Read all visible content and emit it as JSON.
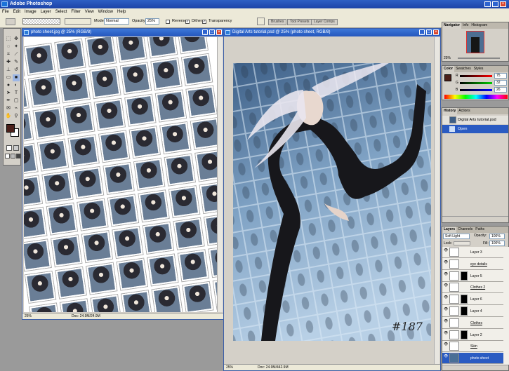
{
  "app": {
    "title": "Adobe Photoshop"
  },
  "menu": [
    "File",
    "Edit",
    "Image",
    "Layer",
    "Select",
    "Filter",
    "View",
    "Window",
    "Help"
  ],
  "options": {
    "mode_label": "Mode:",
    "mode_value": "Normal",
    "opacity_label": "Opacity:",
    "opacity_value": "25%",
    "reverse_label": "Reverse",
    "dither_label": "Dither",
    "transparency_label": "Transparency"
  },
  "palette_well": [
    "Brushes",
    "Tool Presets",
    "Layer Comps"
  ],
  "doc1": {
    "title": "photo sheet.jpg @ 25% (RGB/8)",
    "zoom": "25%",
    "doc_size": "Doc: 24.9M/24.9M"
  },
  "doc2": {
    "title": "Digital Arts tutorial.psd @ 25% (photo sheet, RGB/8)",
    "zoom": "25%",
    "doc_size": "Doc: 24.9M/442.9M",
    "signature": "#187"
  },
  "navigator": {
    "tabs": [
      "Navigator",
      "Info",
      "Histogram"
    ],
    "zoom": "25%"
  },
  "color": {
    "tabs": [
      "Color",
      "Swatches",
      "Styles"
    ],
    "r_label": "R",
    "r_value": "75",
    "g_label": "G",
    "g_value": "32",
    "b_label": "B",
    "b_value": "26",
    "foreground": "#4b201a"
  },
  "history": {
    "tabs": [
      "History",
      "Actions"
    ],
    "snapshot": "Digital Arts tutorial.psd",
    "items": [
      "Open"
    ]
  },
  "layers": {
    "tabs": [
      "Layers",
      "Channels",
      "Paths"
    ],
    "blend_mode": "Soft Light",
    "opacity_label": "Opacity:",
    "opacity_value": "100%",
    "lock_label": "Lock:",
    "fill_label": "Fill:",
    "fill_value": "100%",
    "items": [
      "Layer 3",
      "eye details",
      "Layer 5",
      "Clothes 2",
      "Layer 6",
      "Layer 4",
      "Clothes",
      "Layer 2",
      "Skin",
      "photo sheet"
    ]
  }
}
